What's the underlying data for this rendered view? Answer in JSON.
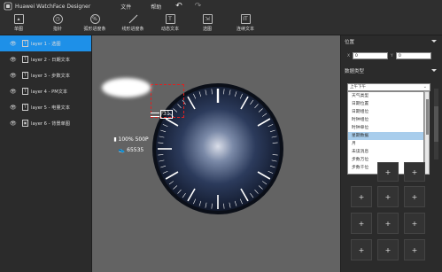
{
  "titlebar": {
    "app_title": "Huawei WatchFace Designer",
    "menu": [
      "文件",
      "帮助"
    ],
    "undo_icon": "undo-icon",
    "redo_icon": "redo-icon"
  },
  "toolbar": {
    "items": [
      {
        "label": "单图",
        "icon": "image-icon"
      },
      {
        "label": "指针",
        "icon": "hand-icon"
      },
      {
        "label": "弧形进度条",
        "icon": "arc-progress-icon"
      },
      {
        "label": "线形进度条",
        "icon": "line-progress-icon"
      },
      {
        "label": "动态文本",
        "icon": "text-icon"
      },
      {
        "label": "选图",
        "icon": "select-image-icon"
      },
      {
        "label": "连续文本",
        "icon": "sequence-text-icon"
      }
    ]
  },
  "layers": [
    {
      "name": "layer 1 - 选图",
      "selected": true,
      "icon": "T"
    },
    {
      "name": "layer 2 - 日期文本",
      "selected": false,
      "icon": "T"
    },
    {
      "name": "layer 3 - 步数文本",
      "selected": false,
      "icon": "T"
    },
    {
      "name": "layer 4 - PM文本",
      "selected": false,
      "icon": "T"
    },
    {
      "name": "layer 5 - 电量文本",
      "selected": false,
      "icon": "T"
    },
    {
      "name": "layer 6 - 背景单图",
      "selected": false,
      "icon": "▣"
    }
  ],
  "watch": {
    "date": "31",
    "battery": "100%  500P",
    "steps": "65535"
  },
  "rightpanel": {
    "position_header": "位置",
    "x_label": "X",
    "x_value": "0",
    "y_label": "Y",
    "y_value": "0",
    "datatype_header": "数据类型",
    "select_value": "上午下午",
    "options": [
      "天气类型",
      "日期位置",
      "日期组位",
      "时钟组位",
      "时钟单位",
      "星期数据",
      "月",
      "未读消息",
      "步数万位",
      "步数千位"
    ],
    "highlighted_index": 5
  },
  "colors": {
    "accent": "#1e90e8",
    "canvas_bg": "#636363",
    "panel_bg": "#2b2b2b"
  }
}
